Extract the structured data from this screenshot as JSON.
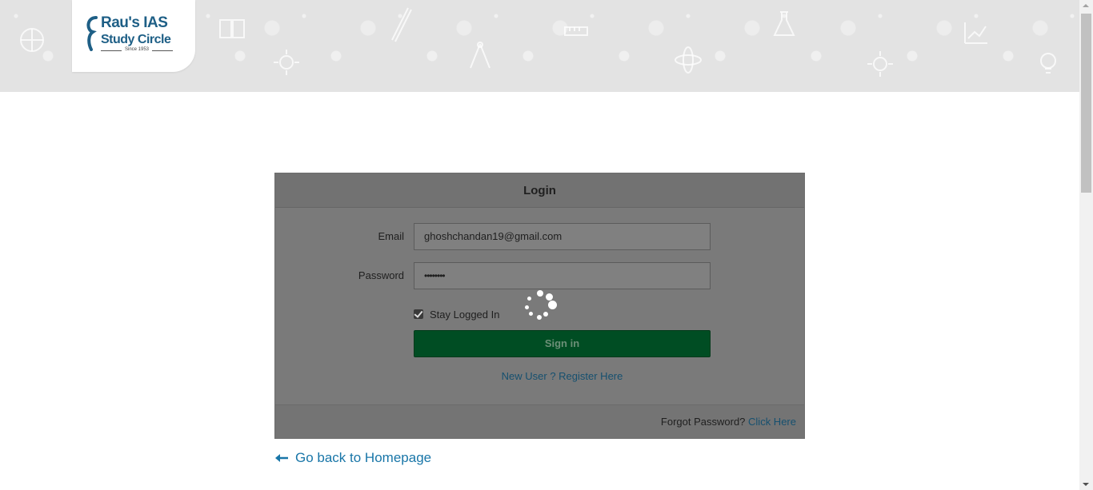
{
  "header": {
    "logo": {
      "line1": "Rau's IAS",
      "line2": "Study Circle",
      "since": "Since 1953"
    }
  },
  "login": {
    "title": "Login",
    "email": {
      "label": "Email",
      "value": "ghoshchandan19@gmail.com"
    },
    "password": {
      "label": "Password",
      "value": "••••••••"
    },
    "remember": {
      "label": "Stay Logged In",
      "checked": true
    },
    "signin_label": "Sign in",
    "register_link": "New User ? Register Here",
    "footer": {
      "forgot_text": "Forgot Password?",
      "click_here": "Click Here"
    }
  },
  "back_link": "Go back to Homepage",
  "colors": {
    "brand_blue": "#1e5f86",
    "signin_green": "#004d23",
    "link_blue": "#1976a8",
    "overlay_gray": "#7a7a7a"
  },
  "icons": [
    "loading-spinner-icon",
    "arrow-left-icon",
    "checkbox-checked-icon"
  ]
}
